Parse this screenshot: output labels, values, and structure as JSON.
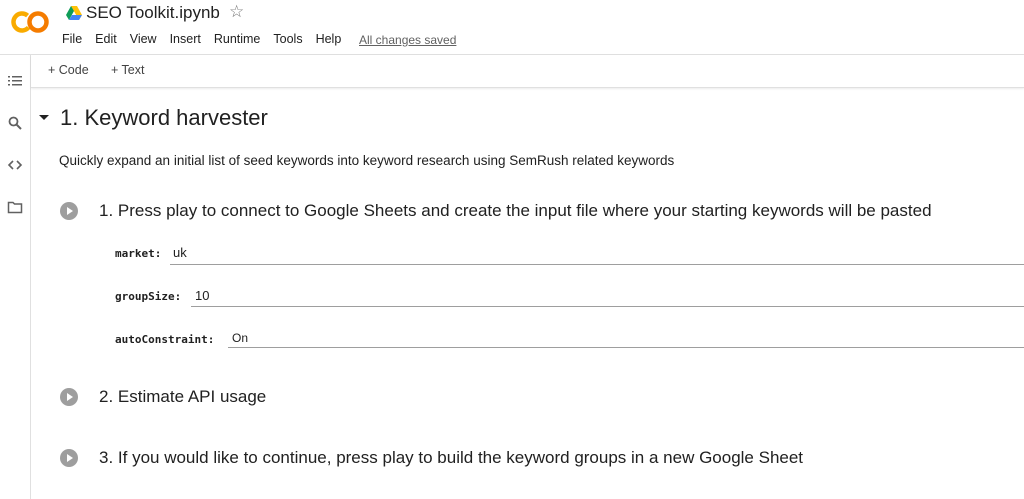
{
  "app": {
    "logo_text": "CO",
    "notebook_title": "SEO Toolkit.ipynb"
  },
  "menu": [
    "File",
    "Edit",
    "View",
    "Insert",
    "Runtime",
    "Tools",
    "Help"
  ],
  "save_status": "All changes saved",
  "toolbar": {
    "code_label": "+ Code",
    "text_label": "+ Text"
  },
  "sidebar": {
    "icons": [
      "table-of-contents-icon",
      "search-icon",
      "code-snippets-icon",
      "files-icon"
    ]
  },
  "section": {
    "title": "1. Keyword harvester",
    "description": "Quickly expand an initial list of seed keywords into keyword research using SemRush related keywords"
  },
  "cells": [
    {
      "title": "1. Press play to connect to Google Sheets and create the input file where your starting keywords will be pasted",
      "fields": [
        {
          "label": "market:",
          "value": "uk"
        },
        {
          "label": "groupSize:",
          "value": "10"
        },
        {
          "label": "autoConstraint:",
          "value": "On"
        }
      ]
    },
    {
      "title": "2. Estimate API usage"
    },
    {
      "title": "3. If you would like to continue, press play to build the keyword groups in a new Google Sheet"
    }
  ],
  "colors": {
    "logo_orange": "#F9AB00",
    "accent": "#F57C00",
    "play_gray": "#9e9e9e"
  }
}
